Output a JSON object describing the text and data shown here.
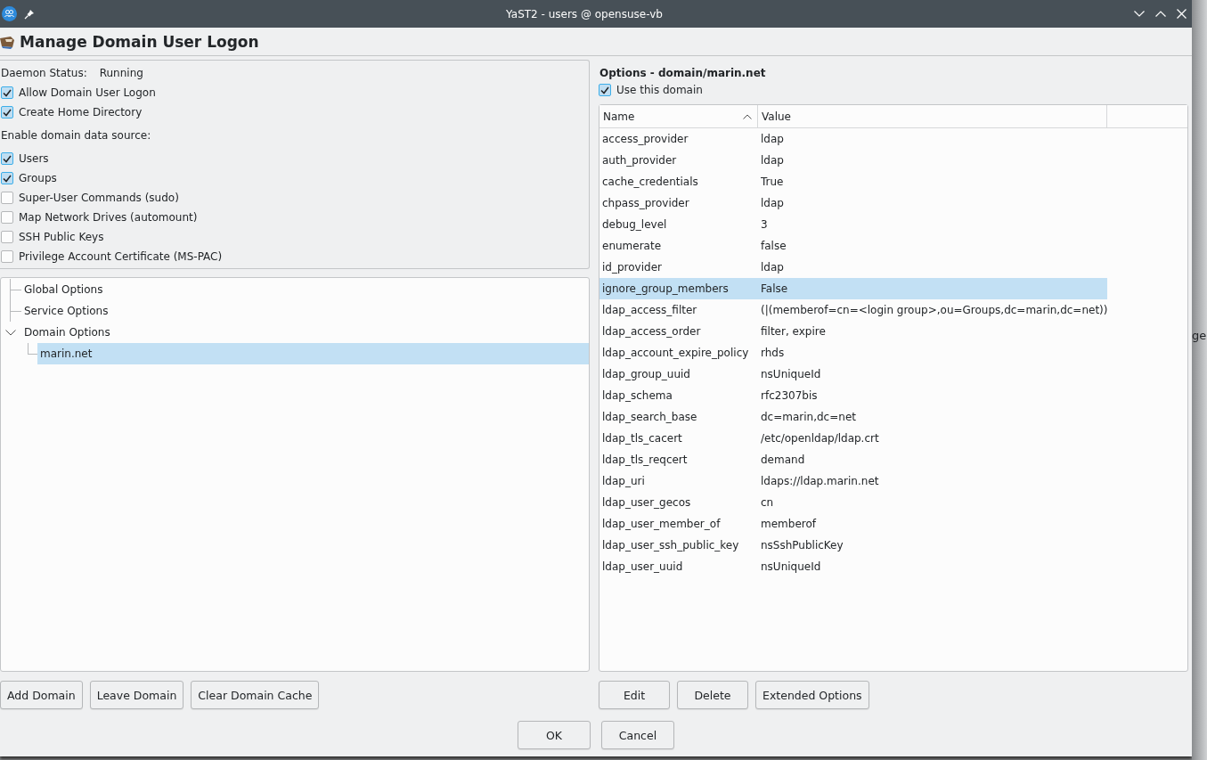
{
  "window": {
    "title": "YaST2 - users @ opensuse-vb"
  },
  "header": {
    "title": "Manage Domain User Logon"
  },
  "daemon_status": {
    "label": "Daemon Status:",
    "value": "Running"
  },
  "logon_options": [
    {
      "label": "Allow Domain User Logon",
      "checked": true
    },
    {
      "label": "Create Home Directory",
      "checked": true
    }
  ],
  "data_source": {
    "label": "Enable domain data source:",
    "items": [
      {
        "label": "Users",
        "checked": true
      },
      {
        "label": "Groups",
        "checked": true
      },
      {
        "label": "Super-User Commands (sudo)",
        "checked": false
      },
      {
        "label": "Map Network Drives (automount)",
        "checked": false
      },
      {
        "label": "SSH Public Keys",
        "checked": false
      },
      {
        "label": "Privilege Account Certificate (MS-PAC)",
        "checked": false
      }
    ]
  },
  "tree": [
    {
      "label": "Global Options",
      "selected": false
    },
    {
      "label": "Service Options",
      "selected": false
    },
    {
      "label": "Domain Options",
      "selected": false,
      "expanded": true,
      "children": [
        {
          "label": "marin.net",
          "selected": true
        }
      ]
    }
  ],
  "left_buttons": [
    "Add Domain",
    "Leave Domain",
    "Clear Domain Cache"
  ],
  "options_panel": {
    "title": "Options - domain/marin.net",
    "use_domain": {
      "label": "Use this domain",
      "checked": true
    },
    "table": {
      "columns": [
        "Name",
        "Value"
      ],
      "rows": [
        {
          "name": "access_provider",
          "value": "ldap",
          "selected": false
        },
        {
          "name": "auth_provider",
          "value": "ldap",
          "selected": false
        },
        {
          "name": "cache_credentials",
          "value": "True",
          "selected": false
        },
        {
          "name": "chpass_provider",
          "value": "ldap",
          "selected": false
        },
        {
          "name": "debug_level",
          "value": "3",
          "selected": false
        },
        {
          "name": "enumerate",
          "value": "false",
          "selected": false
        },
        {
          "name": "id_provider",
          "value": "ldap",
          "selected": false
        },
        {
          "name": "ignore_group_members",
          "value": "False",
          "selected": true
        },
        {
          "name": "ldap_access_filter",
          "value": "(|(memberof=cn=<login group>,ou=Groups,dc=marin,dc=net))",
          "selected": false
        },
        {
          "name": "ldap_access_order",
          "value": "filter, expire",
          "selected": false
        },
        {
          "name": "ldap_account_expire_policy",
          "value": "rhds",
          "selected": false
        },
        {
          "name": "ldap_group_uuid",
          "value": "nsUniqueId",
          "selected": false
        },
        {
          "name": "ldap_schema",
          "value": "rfc2307bis",
          "selected": false
        },
        {
          "name": "ldap_search_base",
          "value": "dc=marin,dc=net",
          "selected": false
        },
        {
          "name": "ldap_tls_cacert",
          "value": "/etc/openldap/ldap.crt",
          "selected": false
        },
        {
          "name": "ldap_tls_reqcert",
          "value": "demand",
          "selected": false
        },
        {
          "name": "ldap_uri",
          "value": "ldaps://ldap.marin.net",
          "selected": false
        },
        {
          "name": "ldap_user_gecos",
          "value": "cn",
          "selected": false
        },
        {
          "name": "ldap_user_member_of",
          "value": "memberof",
          "selected": false
        },
        {
          "name": "ldap_user_ssh_public_key",
          "value": "nsSshPublicKey",
          "selected": false
        },
        {
          "name": "ldap_user_uuid",
          "value": "nsUniqueId",
          "selected": false
        }
      ]
    }
  },
  "right_buttons": [
    "Edit",
    "Delete",
    "Extended Options"
  ],
  "dialog_buttons": [
    "OK",
    "Cancel"
  ],
  "background_fragment": "ge"
}
